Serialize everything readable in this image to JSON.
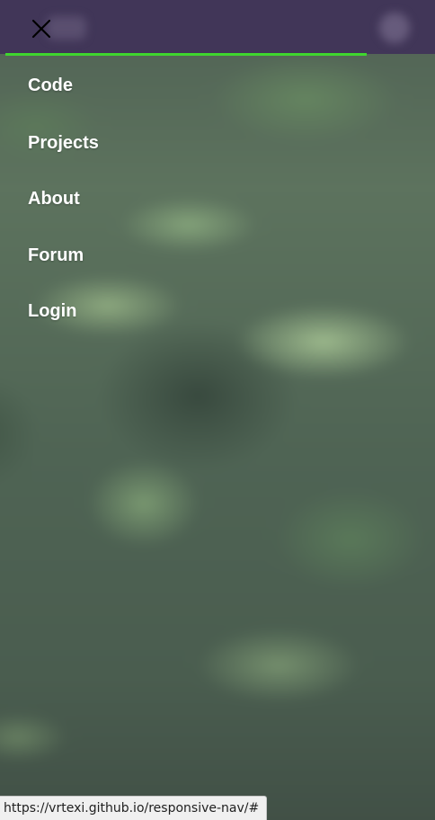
{
  "nav": {
    "close_icon": "close-icon",
    "accent_color": "#3fd62e",
    "items": [
      {
        "label": "Code"
      },
      {
        "label": "Projects"
      },
      {
        "label": "About"
      },
      {
        "label": "Forum"
      },
      {
        "label": "Login"
      }
    ]
  },
  "status": {
    "url": "https://vrtexi.github.io/responsive-nav/#"
  }
}
